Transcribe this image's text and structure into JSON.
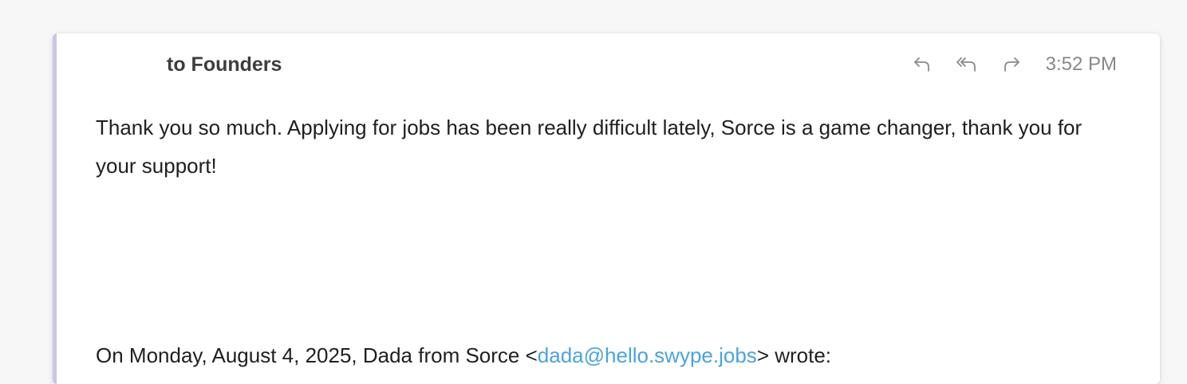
{
  "email": {
    "recipient_line": "to Founders",
    "time": "3:52 PM",
    "body": "Thank you so much. Applying for jobs has been really difficult lately, Sorce is a game changer, thank you for your support!",
    "quote": {
      "prefix": "On Monday, August 4, 2025, Dada from Sorce <",
      "email_link": "dada@hello.swype.jobs",
      "suffix": "> wrote:"
    }
  },
  "icons": {
    "reply": "reply-icon",
    "reply_all": "reply-all-icon",
    "forward": "forward-icon"
  },
  "colors": {
    "accent_bar": "#c9c6eb",
    "link": "#4aa3df",
    "icon": "#8a8a8a",
    "timestamp": "#888888"
  }
}
